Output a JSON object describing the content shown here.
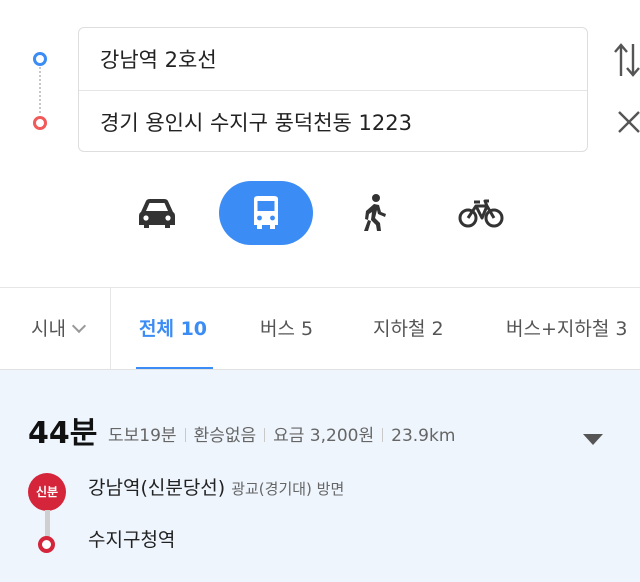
{
  "route": {
    "origin": "강남역 2호선",
    "destination": "경기 용인시 수지구 풍덕천동 1223"
  },
  "icons": {
    "swap": "swap-arrows-icon",
    "clear": "close-icon",
    "car": "car-icon",
    "bus": "bus-icon",
    "walk": "walking-person-icon",
    "bike": "bicycle-icon"
  },
  "modes": {
    "selected": "bus"
  },
  "tabs": {
    "region": "시내",
    "all": "전체 10",
    "bus": "버스 5",
    "subway": "지하철 2",
    "bus_subway": "버스+지하철 3"
  },
  "result": {
    "time": "44분",
    "walk": "도보19분",
    "transfer": "환승없음",
    "fare": "요금 3,200원",
    "distance": "23.9km",
    "line_badge": "신분",
    "start_stop": "강남역(신분당선)",
    "direction": "광교(경기대) 방면",
    "end_stop": "수지구청역"
  },
  "colors": {
    "accent": "#3b8cf5",
    "origin_dot": "#3b8cf5",
    "dest_dot": "#f05a5a",
    "line_color": "#d4253a",
    "result_bg": "#eef5fd"
  }
}
